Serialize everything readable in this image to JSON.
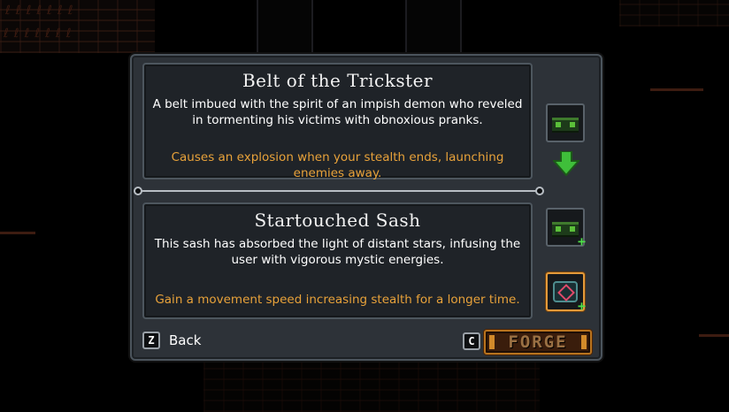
{
  "items": {
    "current": {
      "name": "Belt of the Trickster",
      "description": "A belt imbued with the spirit of an impish demon who reveled in tormenting his victims with obnoxious pranks.",
      "effect": "Causes an explosion when your stealth ends, launching enemies away."
    },
    "upgrade": {
      "name": "Startouched Sash",
      "description": "This sash has absorbed the light of distant stars, infusing the user with vigorous mystic energies.",
      "effect": "Gain a movement speed increasing stealth for a longer time."
    }
  },
  "slots": {
    "current_icon": "belt-icon",
    "arrow_icon": "arrow-down-icon",
    "candidate_icon": "belt-plus-icon",
    "selected_icon": "sash-plus-icon"
  },
  "footer": {
    "back_key": "Z",
    "back_label": "Back",
    "forge_key": "C",
    "forge_label": "FORGE"
  },
  "colors": {
    "effect_text": "#e8a23a",
    "selected_border": "#e39a3a",
    "upgrade_plus": "#4fe04a",
    "arrow": "#3fbf3a"
  }
}
